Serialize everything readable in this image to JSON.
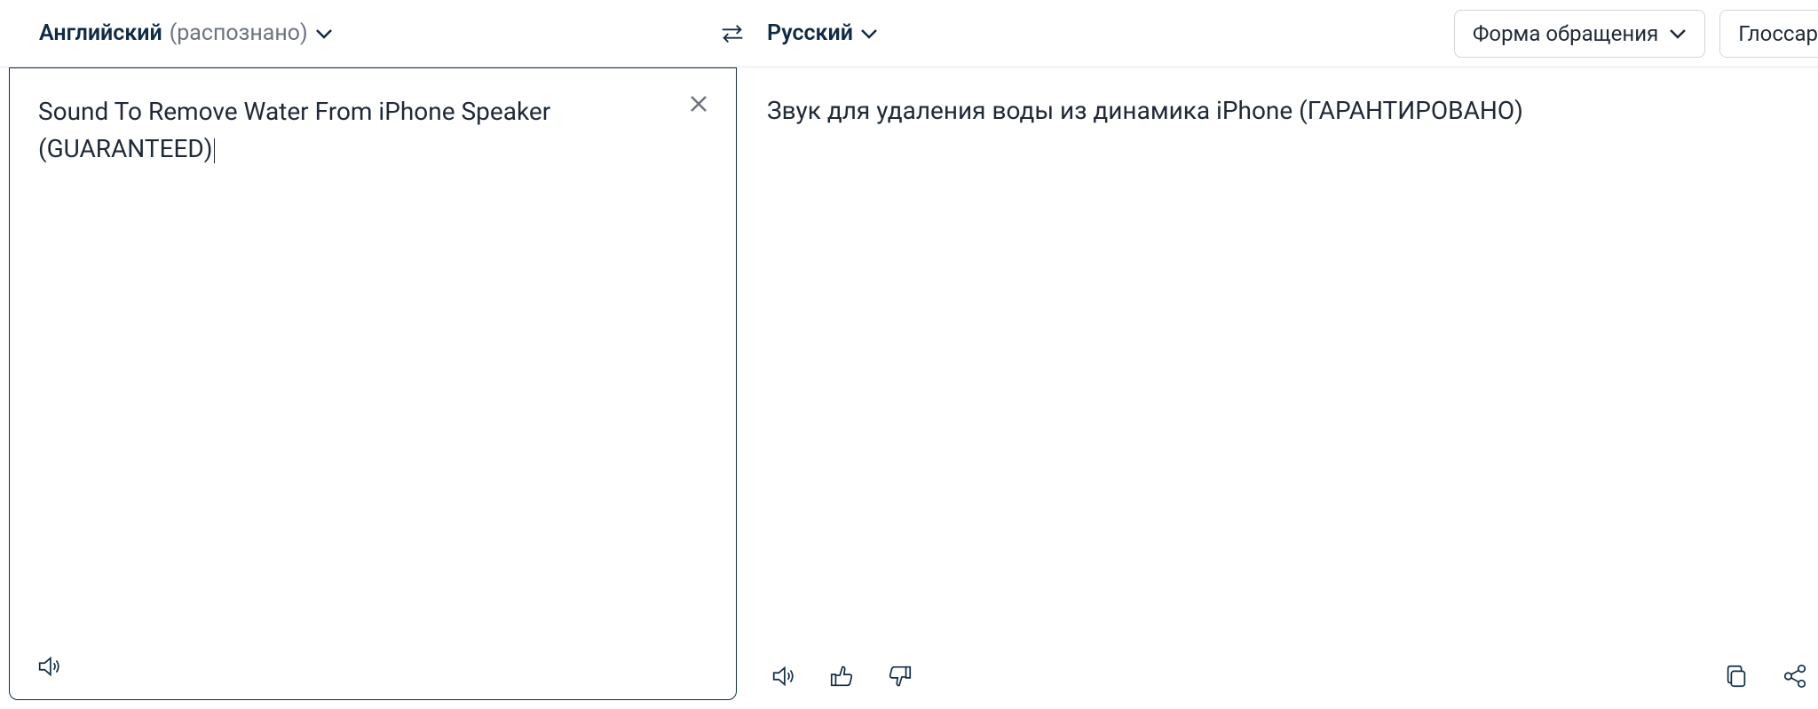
{
  "header": {
    "source_lang": "Английский",
    "source_detected": "(распознано)",
    "target_lang": "Русский",
    "formality_label": "Форма обращения",
    "glossary_label": "Глоссар"
  },
  "source": {
    "text": "Sound To Remove Water From iPhone Speaker (GUARANTEED)"
  },
  "target": {
    "text": "Звук для удаления воды из динамика iPhone (ГАРАНТИРОВАНО)"
  }
}
